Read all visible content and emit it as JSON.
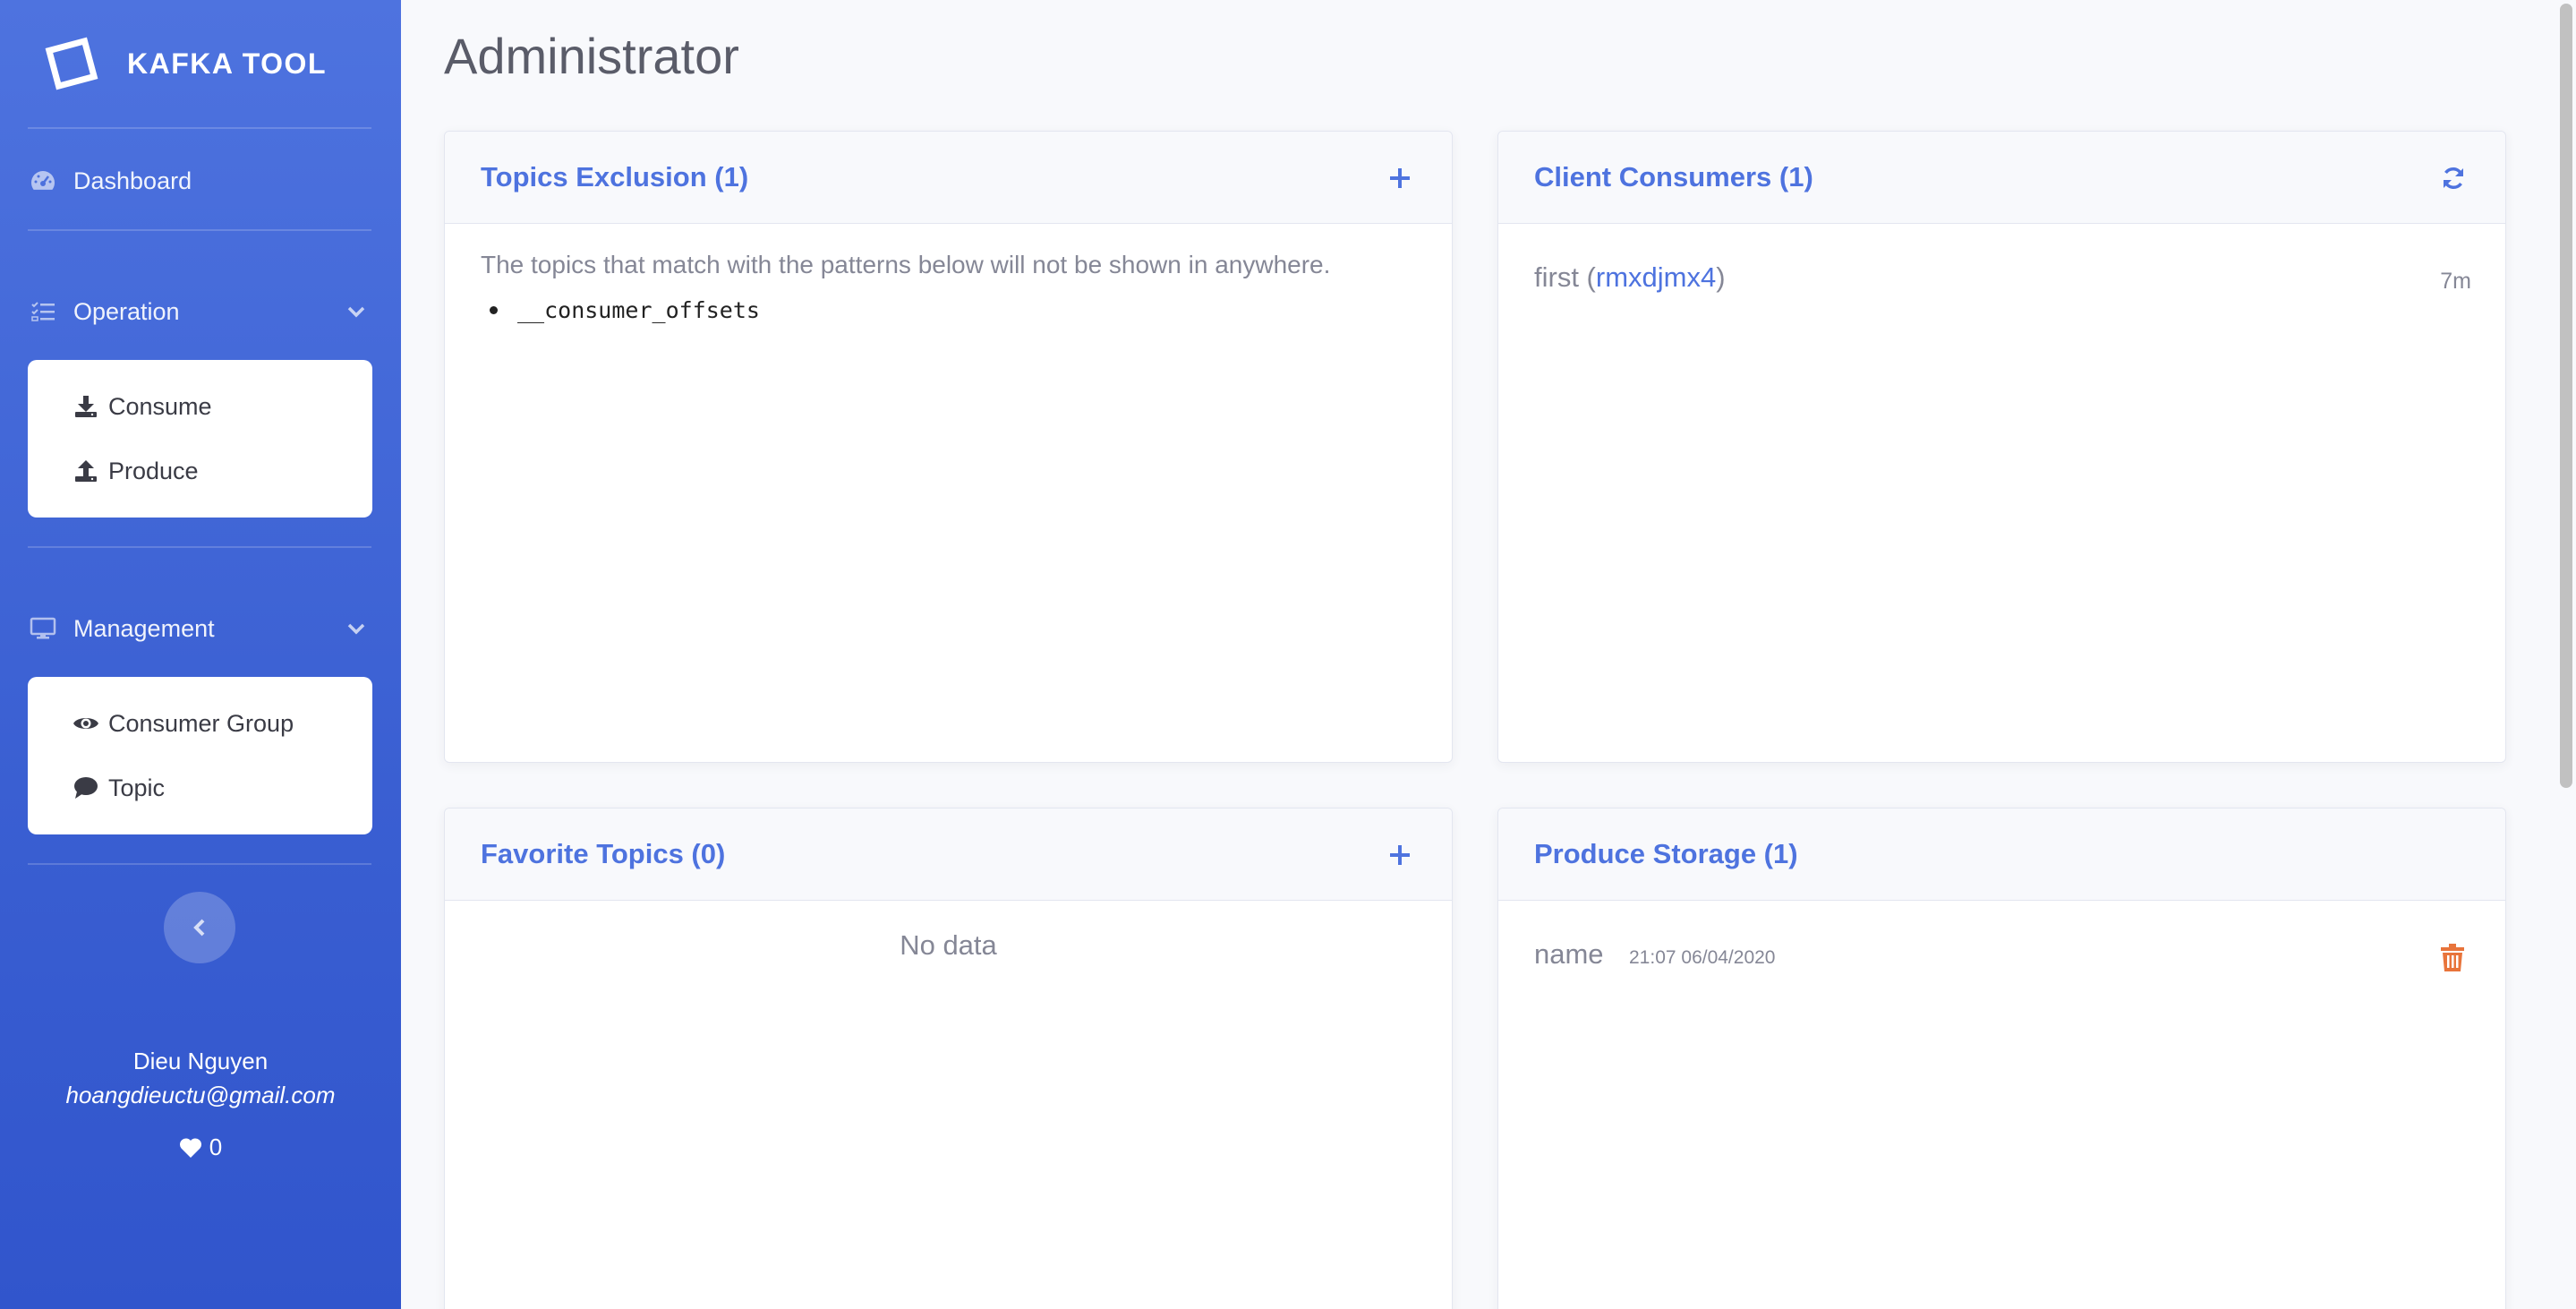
{
  "brand": {
    "name": "KAFKA TOOL"
  },
  "sidebar": {
    "dashboard": "Dashboard",
    "operation": {
      "label": "Operation",
      "items": [
        {
          "label": "Consume",
          "icon": "download-icon"
        },
        {
          "label": "Produce",
          "icon": "upload-icon"
        }
      ]
    },
    "management": {
      "label": "Management",
      "items": [
        {
          "label": "Consumer Group",
          "icon": "eye-icon"
        },
        {
          "label": "Topic",
          "icon": "comment-icon"
        }
      ]
    },
    "user": {
      "name": "Dieu Nguyen",
      "email": "hoangdieuctu@gmail.com",
      "likes": "0"
    }
  },
  "page": {
    "title": "Administrator"
  },
  "cards": {
    "topics_exclusion": {
      "title": "Topics Exclusion (1)",
      "description": "The topics that match with the patterns below will not be shown in anywhere.",
      "patterns": [
        "__consumer_offsets"
      ]
    },
    "client_consumers": {
      "title": "Client Consumers (1)",
      "consumers": [
        {
          "name": "first",
          "id": "rmxdjmx4",
          "age": "7m"
        }
      ]
    },
    "favorite_topics": {
      "title": "Favorite Topics (0)",
      "empty_text": "No data"
    },
    "produce_storage": {
      "title": "Produce Storage (1)",
      "items": [
        {
          "name": "name",
          "date": "21:07 06/04/2020"
        }
      ]
    }
  },
  "colors": {
    "primary": "#4e73df",
    "sidebar_gradient_top": "#4e73df",
    "sidebar_gradient_bottom": "#3155cc",
    "text_muted": "#858796",
    "danger": "#e8743b"
  }
}
